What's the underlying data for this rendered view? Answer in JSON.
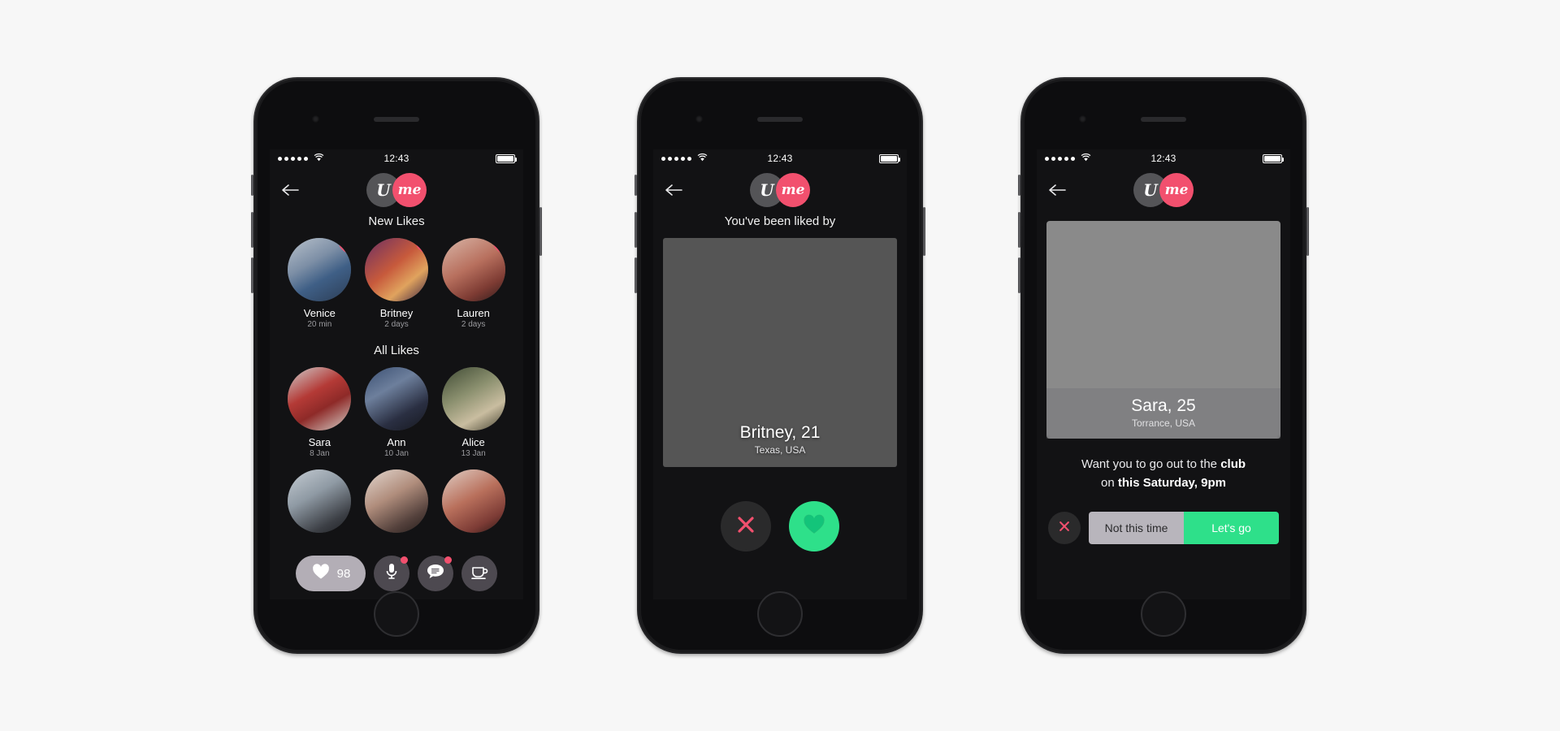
{
  "status_bar": {
    "signal_dots": 5,
    "wifi_icon": "wifi-icon",
    "time": "12:43",
    "battery_icon": "battery-full-icon"
  },
  "brand": {
    "logo_u": "U",
    "logo_me": "me",
    "accent_pink": "#f2506e",
    "accent_green": "#2ee08a",
    "screen_bg": "#121214"
  },
  "phone1": {
    "back_icon": "back-arrow-icon",
    "new_likes_title": "New Likes",
    "all_likes_title": "All Likes",
    "new_likes": [
      {
        "name": "Venice",
        "meta": "20 min",
        "photo": "ph-venice",
        "badge": "heart-icon"
      },
      {
        "name": "Britney",
        "meta": "2 days",
        "photo": "ph-britney",
        "badge": "heart-icon"
      },
      {
        "name": "Lauren",
        "meta": "2 days",
        "photo": "ph-lauren",
        "badge": "heart-icon"
      }
    ],
    "all_likes": [
      {
        "name": "Sara",
        "meta": "8 Jan",
        "photo": "ph-sara"
      },
      {
        "name": "Ann",
        "meta": "10 Jan",
        "photo": "ph-ann"
      },
      {
        "name": "Alice",
        "meta": "13 Jan",
        "photo": "ph-alice"
      }
    ],
    "all_likes_row2": [
      {
        "photo": "ph-g1"
      },
      {
        "photo": "ph-g2"
      },
      {
        "photo": "ph-g3"
      }
    ],
    "tabbar": {
      "likes_count": "98",
      "likes_icon": "heart-icon",
      "mic_icon": "microphone-icon",
      "chat_icon": "chat-bubble-icon",
      "coffee_icon": "coffee-cup-icon",
      "mic_has_notification": true,
      "chat_has_notification": true
    }
  },
  "phone2": {
    "back_icon": "back-arrow-icon",
    "title": "You've been liked by",
    "card": {
      "name": "Britney, 21",
      "location": "Texas, USA",
      "photo": "ph-street"
    },
    "pass_icon": "close-x-icon",
    "like_icon": "heart-icon"
  },
  "phone3": {
    "back_icon": "back-arrow-icon",
    "card": {
      "name": "Sara, 25",
      "location": "Torrance, USA",
      "photo": "ph-studio"
    },
    "invite_line1_pre": "Want you to go out to the ",
    "invite_line1_bold": "club",
    "invite_line2_pre": "on ",
    "invite_line2_bold": "this Saturday, 9pm",
    "close_icon": "close-x-icon",
    "decline_label": "Not this time",
    "accept_label": "Let's go"
  }
}
